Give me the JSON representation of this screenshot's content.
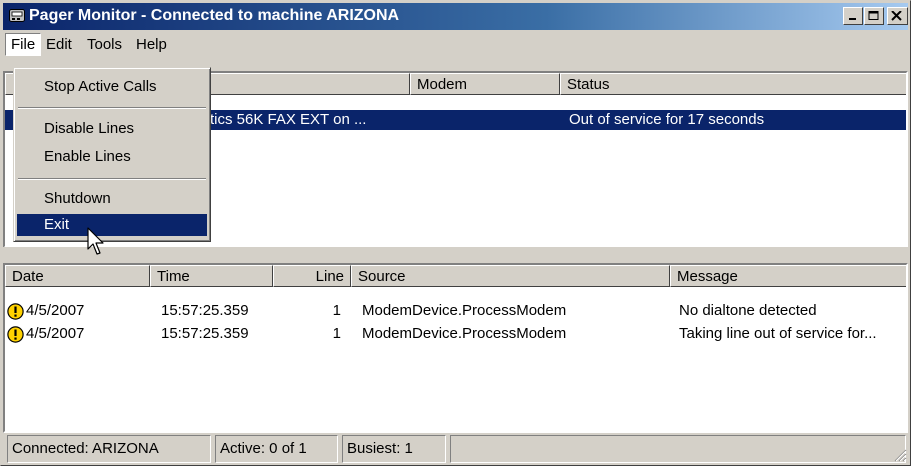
{
  "window": {
    "title": "Pager Monitor - Connected to machine ARIZONA",
    "title_icon": "pager-app-icon",
    "controls": [
      "minimize-icon",
      "maximize-icon",
      "close-icon"
    ]
  },
  "menubar": {
    "items": [
      "File",
      "Edit",
      "Tools",
      "Help"
    ],
    "active": "File"
  },
  "file_menu": {
    "items": [
      {
        "label": "Stop Active Calls"
      },
      {
        "label": "Disable Lines"
      },
      {
        "label": "Enable Lines"
      },
      {
        "label": "Shutdown"
      },
      {
        "label": "Exit",
        "highlighted": true
      }
    ]
  },
  "lines_table": {
    "columns": [
      "Modem",
      "Status"
    ],
    "rows": [
      {
        "modem_partial": "tics 56K FAX EXT on ...",
        "status": "Out of service for 17 seconds",
        "selected": true
      }
    ]
  },
  "log_table": {
    "columns": [
      "Date",
      "Time",
      "Line",
      "Source",
      "Message"
    ],
    "rows": [
      {
        "icon": "warning-icon",
        "date": "4/5/2007",
        "time": "15:57:25.359",
        "line": "1",
        "source": "ModemDevice.ProcessModem",
        "message": "No dialtone detected"
      },
      {
        "icon": "warning-icon",
        "date": "4/5/2007",
        "time": "15:57:25.359",
        "line": "1",
        "source": "ModemDevice.ProcessModem",
        "message": "Taking line out of service for..."
      }
    ]
  },
  "statusbar": {
    "connected": "Connected: ARIZONA",
    "active": "Active: 0 of 1",
    "busiest": "Busiest: 1"
  },
  "colors": {
    "titlebar_start": "#0a246a",
    "titlebar_end": "#a6caf0",
    "selection": "#0a246a",
    "face": "#d4d0c8",
    "warning": "#ffd200"
  }
}
